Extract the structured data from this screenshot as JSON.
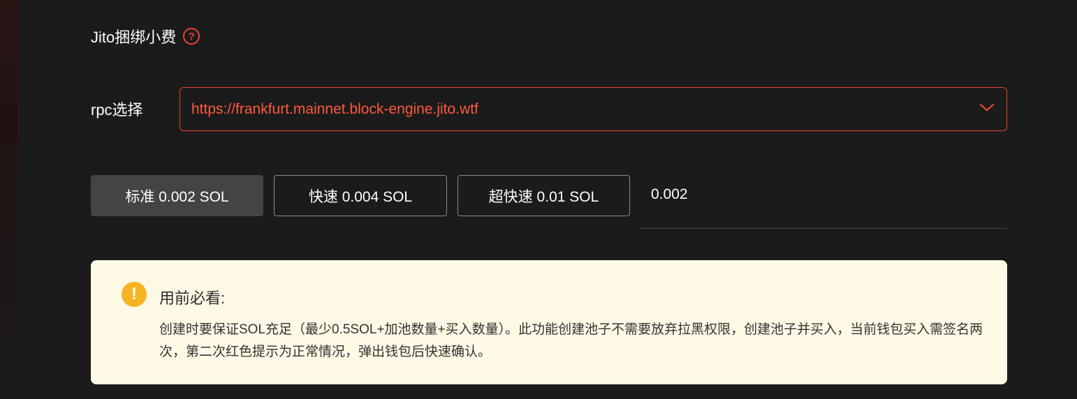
{
  "jito": {
    "title": "Jito捆绑小费",
    "help_icon": "question-circle-icon",
    "help_glyph": "?"
  },
  "rpc": {
    "label": "rpc选择",
    "selected": "https://frankfurt.mainnet.block-engine.jito.wtf",
    "dropdown_icon": "chevron-down-icon"
  },
  "fee_options": [
    {
      "label": "标准 0.002 SOL",
      "active": true
    },
    {
      "label": "快速 0.004 SOL",
      "active": false
    },
    {
      "label": "超快速 0.01 SOL",
      "active": false
    }
  ],
  "custom_fee": {
    "value": "0.002"
  },
  "notice": {
    "icon": "warning-icon",
    "icon_glyph": "!",
    "title": "用前必看:",
    "body": "创建时要保证SOL充足（最少0.5SOL+加池数量+买入数量）。此功能创建池子不需要放弃拉黑权限，创建池子并买入，当前钱包买入需签名两次，第二次红色提示为正常情况，弹出钱包后快速确认。"
  },
  "colors": {
    "background": "#1b1b1b",
    "accent": "#e8462f",
    "notice_bg": "#fef9e5",
    "warning": "#f5b324"
  }
}
